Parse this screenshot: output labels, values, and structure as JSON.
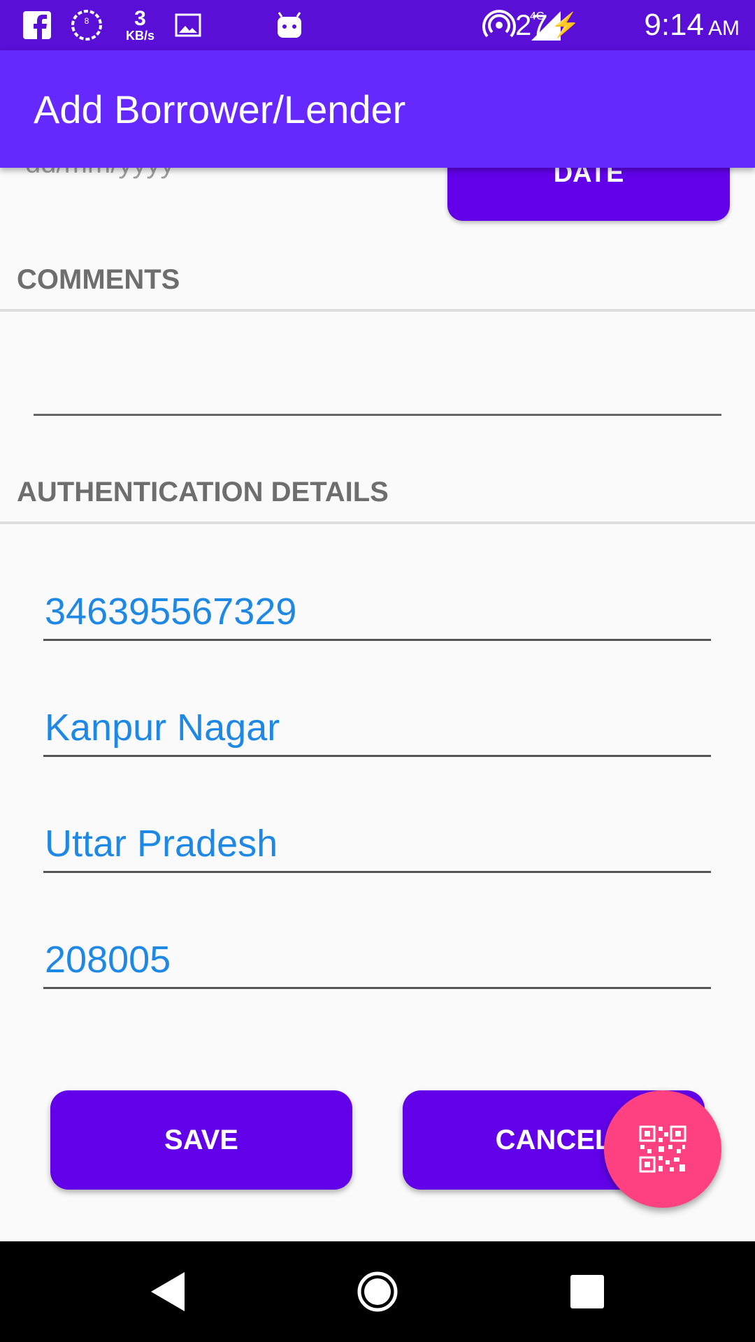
{
  "status_bar": {
    "network_speed_value": "3",
    "network_speed_unit": "KB/s",
    "network_type": "4G",
    "battery": "27",
    "time": "9:14",
    "ampm": "AM",
    "icons": [
      "facebook-icon",
      "badge-icon",
      "image-icon",
      "android-icon",
      "hotspot-icon",
      "signal-icon",
      "charging-icon"
    ]
  },
  "app_bar": {
    "title": "Add Borrower/Lender"
  },
  "date": {
    "placeholder": "dd/mm/yyyy",
    "button_label": "DATE"
  },
  "comments": {
    "header": "COMMENTS",
    "value": ""
  },
  "authentication": {
    "header": "AUTHENTICATION DETAILS",
    "fields": [
      "346395567329",
      "Kanpur Nagar",
      "Uttar Pradesh",
      "208005"
    ]
  },
  "actions": {
    "save_label": "SAVE",
    "cancel_label": "CANCEL"
  },
  "fab": {
    "icon": "qr-code-icon"
  },
  "nav_bar": {
    "icons": [
      "back-icon",
      "home-icon",
      "recents-icon"
    ]
  },
  "colors": {
    "primary": "#6529ff",
    "button": "#6200ea",
    "accent": "#ff4081",
    "field_text": "#1e88e5"
  }
}
